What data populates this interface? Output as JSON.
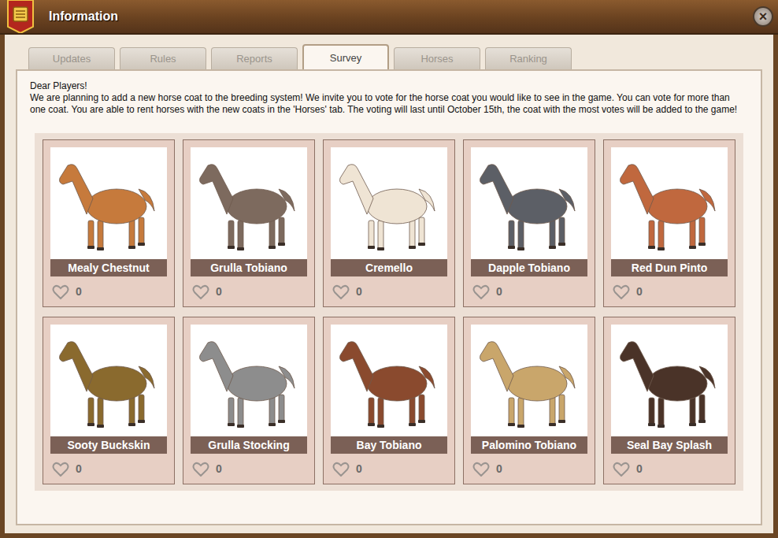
{
  "window": {
    "title": "Information",
    "close": "×"
  },
  "tabs": [
    {
      "label": "Updates",
      "selected": false
    },
    {
      "label": "Rules",
      "selected": false
    },
    {
      "label": "Reports",
      "selected": false
    },
    {
      "label": "Survey",
      "selected": true
    },
    {
      "label": "Horses",
      "selected": false
    },
    {
      "label": "Ranking",
      "selected": false
    }
  ],
  "intro": {
    "greeting": "Dear Players!",
    "body": "We are planning to add a new horse coat to the breeding system! We invite you to vote for the horse coat you would like to see in the game. You can vote for more than one coat. You are able to rent horses with the new coats in the 'Horses' tab. The voting will last until October 15th, the coat with the most votes will be added to the game!"
  },
  "coats": [
    {
      "name": "Mealy Chestnut",
      "votes": "0",
      "color": "#c67a3c"
    },
    {
      "name": "Grulla Tobiano",
      "votes": "0",
      "color": "#7d6a5e"
    },
    {
      "name": "Cremello",
      "votes": "0",
      "color": "#efe4d4"
    },
    {
      "name": "Dapple Tobiano",
      "votes": "0",
      "color": "#5c5f66"
    },
    {
      "name": "Red Dun Pinto",
      "votes": "0",
      "color": "#c0683e"
    },
    {
      "name": "Sooty Buckskin",
      "votes": "0",
      "color": "#8a6a2e"
    },
    {
      "name": "Grulla Stocking",
      "votes": "0",
      "color": "#8d8d8d"
    },
    {
      "name": "Bay Tobiano",
      "votes": "0",
      "color": "#8a4a2e"
    },
    {
      "name": "Palomino Tobiano",
      "votes": "0",
      "color": "#c9a66b"
    },
    {
      "name": "Seal Bay Splash",
      "votes": "0",
      "color": "#4a3328"
    }
  ]
}
